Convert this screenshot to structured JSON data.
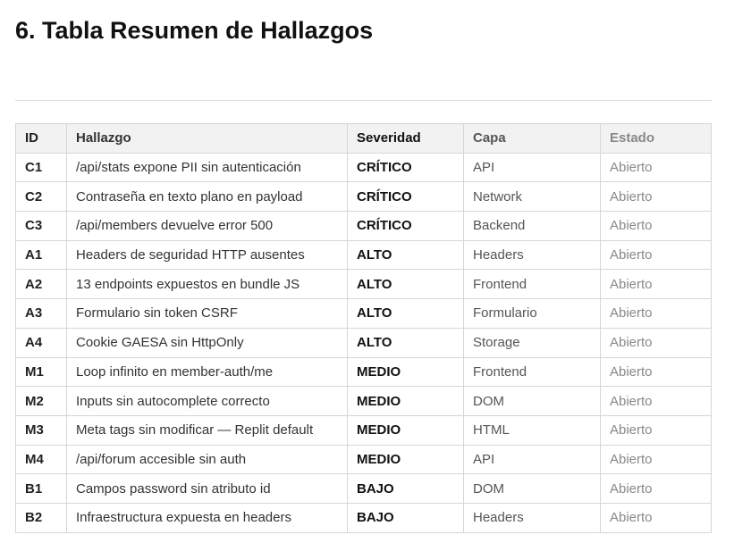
{
  "heading": "6. Tabla Resumen de Hallazgos",
  "table": {
    "headers": [
      "ID",
      "Hallazgo",
      "Severidad",
      "Capa",
      "Estado"
    ],
    "rows": [
      {
        "id": "C1",
        "hallazgo": "/api/stats expone PII sin autenticación",
        "severidad": "CRÍTICO",
        "capa": "API",
        "estado": "Abierto"
      },
      {
        "id": "C2",
        "hallazgo": "Contraseña en texto plano en payload",
        "severidad": "CRÍTICO",
        "capa": "Network",
        "estado": "Abierto"
      },
      {
        "id": "C3",
        "hallazgo": "/api/members devuelve error 500",
        "severidad": "CRÍTICO",
        "capa": "Backend",
        "estado": "Abierto"
      },
      {
        "id": "A1",
        "hallazgo": "Headers de seguridad HTTP ausentes",
        "severidad": "ALTO",
        "capa": "Headers",
        "estado": "Abierto"
      },
      {
        "id": "A2",
        "hallazgo": "13 endpoints expuestos en bundle JS",
        "severidad": "ALTO",
        "capa": "Frontend",
        "estado": "Abierto"
      },
      {
        "id": "A3",
        "hallazgo": "Formulario sin token CSRF",
        "severidad": "ALTO",
        "capa": "Formulario",
        "estado": "Abierto"
      },
      {
        "id": "A4",
        "hallazgo": "Cookie GAESA sin HttpOnly",
        "severidad": "ALTO",
        "capa": "Storage",
        "estado": "Abierto"
      },
      {
        "id": "M1",
        "hallazgo": "Loop infinito en member-auth/me",
        "severidad": "MEDIO",
        "capa": "Frontend",
        "estado": "Abierto"
      },
      {
        "id": "M2",
        "hallazgo": "Inputs sin autocomplete correcto",
        "severidad": "MEDIO",
        "capa": "DOM",
        "estado": "Abierto"
      },
      {
        "id": "M3",
        "hallazgo": "Meta tags sin modificar — Replit default",
        "severidad": "MEDIO",
        "capa": "HTML",
        "estado": "Abierto"
      },
      {
        "id": "M4",
        "hallazgo": "/api/forum accesible sin auth",
        "severidad": "MEDIO",
        "capa": "API",
        "estado": "Abierto"
      },
      {
        "id": "B1",
        "hallazgo": "Campos password sin atributo id",
        "severidad": "BAJO",
        "capa": "DOM",
        "estado": "Abierto"
      },
      {
        "id": "B2",
        "hallazgo": "Infraestructura expuesta en headers",
        "severidad": "BAJO",
        "capa": "Headers",
        "estado": "Abierto"
      }
    ]
  }
}
